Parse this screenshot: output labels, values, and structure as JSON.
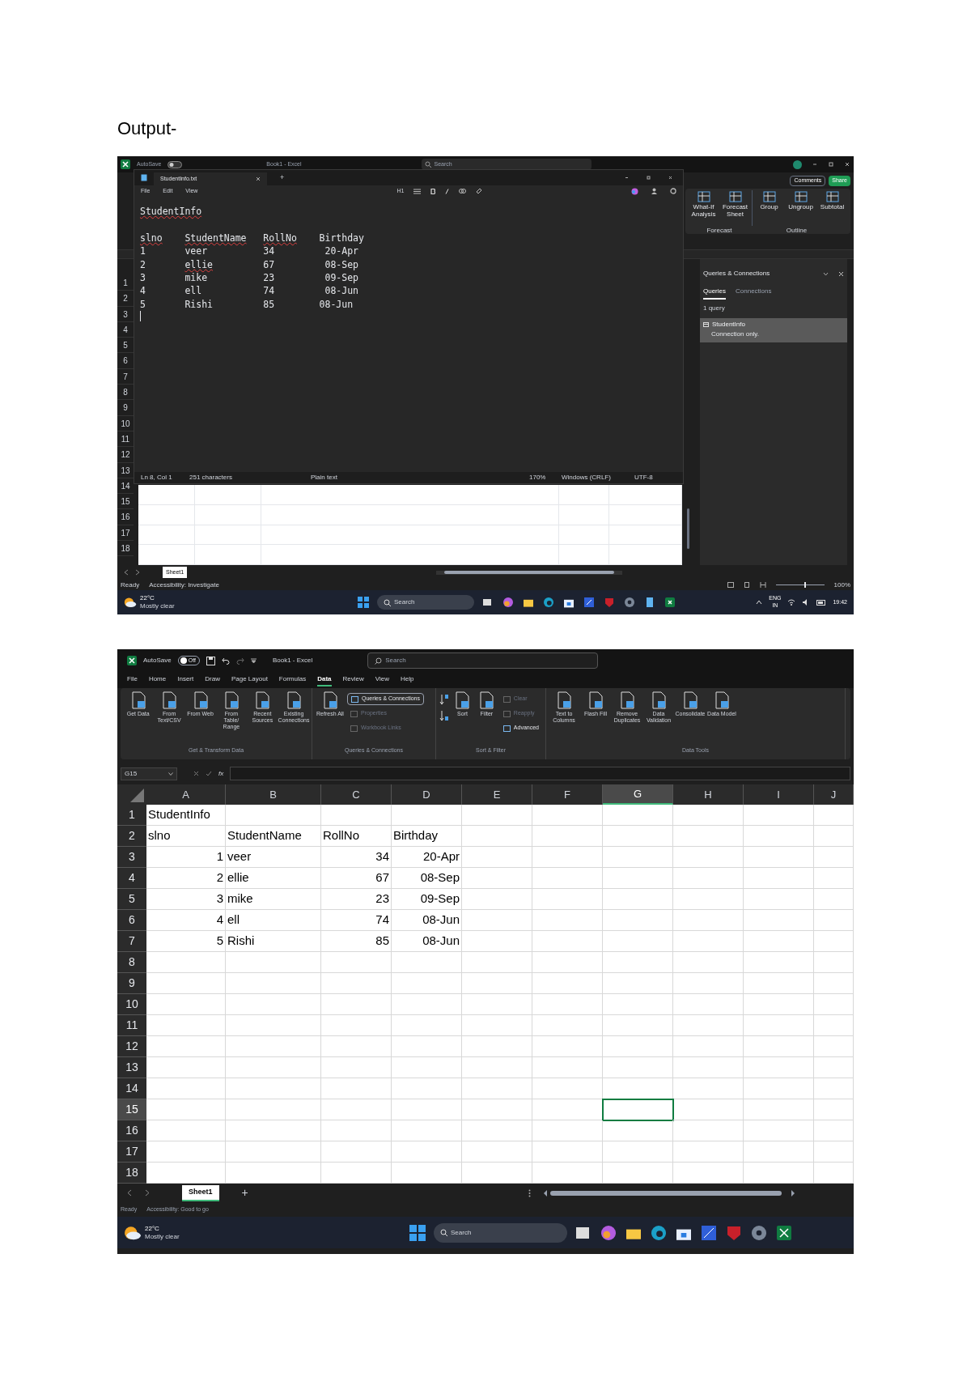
{
  "heading": "Output-",
  "shot1": {
    "excel_title": {
      "autosave": "AutoSave",
      "title": "Book1 - Excel",
      "search": "Search"
    },
    "ribbon_buttons": [
      "Comments",
      "Share"
    ],
    "ribbon_items": [
      "What-If Analysis",
      "Forecast Sheet",
      "Group",
      "Ungroup",
      "Subtotal"
    ],
    "ribbon_groups": [
      "Forecast",
      "Outline"
    ],
    "row_numbers": [
      "1",
      "2",
      "3",
      "4",
      "5",
      "6",
      "7",
      "8",
      "9",
      "10",
      "11",
      "12",
      "13",
      "14",
      "15",
      "16",
      "17",
      "18"
    ],
    "notepad": {
      "tab": "StudentInfo.txt",
      "new_tab": "+",
      "menu": [
        "File",
        "Edit",
        "View"
      ],
      "heading_button": "H1",
      "lines": [
        [
          {
            "text": "StudentInfo",
            "misspelled": true
          }
        ],
        [
          {
            "text": "slno",
            "misspelled": true
          },
          {
            "text": "StudentName",
            "misspelled": true
          },
          {
            "text": "RollNo",
            "misspelled": true
          },
          {
            "text": "Birthday",
            "misspelled": false
          }
        ],
        [
          {
            "text": "1",
            "misspelled": false
          },
          {
            "text": "veer",
            "misspelled": false
          },
          {
            "text": "34",
            "misspelled": false
          },
          {
            "text": " 20-Apr",
            "misspelled": false
          }
        ],
        [
          {
            "text": "2",
            "misspelled": false
          },
          {
            "text": "ellie",
            "misspelled": true
          },
          {
            "text": "67",
            "misspelled": false
          },
          {
            "text": " 08-Sep",
            "misspelled": false
          }
        ],
        [
          {
            "text": "3",
            "misspelled": false
          },
          {
            "text": "mike",
            "misspelled": false
          },
          {
            "text": "23",
            "misspelled": false
          },
          {
            "text": " 09-Sep",
            "misspelled": false
          }
        ],
        [
          {
            "text": "4",
            "misspelled": false
          },
          {
            "text": "ell",
            "misspelled": false
          },
          {
            "text": "74",
            "misspelled": false
          },
          {
            "text": " 08-Jun",
            "misspelled": false
          }
        ],
        [
          {
            "text": "5",
            "misspelled": false
          },
          {
            "text": "Rishi",
            "misspelled": false
          },
          {
            "text": "85",
            "misspelled": false
          },
          {
            "text": "08-Jun",
            "misspelled": false
          }
        ]
      ],
      "status": [
        "Ln 8, Col 1",
        "251 characters",
        "Plain text",
        "170%",
        "Windows (CRLF)",
        "UTF-8"
      ]
    },
    "queries_panel": {
      "title": "Queries & Connections",
      "tabs": [
        {
          "label": "Queries",
          "selected": true
        },
        {
          "label": "Connections",
          "selected": false
        }
      ],
      "count": "1 query",
      "item": {
        "name": "StudentInfo",
        "detail": "Connection only."
      }
    },
    "sheet_tab": "Sheet1",
    "status": [
      "Ready",
      "Accessibility: Investigate"
    ],
    "zoom": "100%",
    "zoom_slider": {
      "level": 0.6
    },
    "taskbar": {
      "temperature": "22°C",
      "weather": "Mostly clear",
      "search": "Search",
      "language": "ENG",
      "region": "IN",
      "time": "19:42"
    }
  },
  "shot2": {
    "title_bar": {
      "autosave": "AutoSave",
      "toggle": "Off",
      "title": "Book1 - Excel",
      "search": "Search"
    },
    "tabs": [
      {
        "label": "File",
        "selected": false
      },
      {
        "label": "Home",
        "selected": false
      },
      {
        "label": "Insert",
        "selected": false
      },
      {
        "label": "Draw",
        "selected": false
      },
      {
        "label": "Page Layout",
        "selected": false
      },
      {
        "label": "Formulas",
        "selected": false
      },
      {
        "label": "Data",
        "selected": true
      },
      {
        "label": "Review",
        "selected": false
      },
      {
        "label": "View",
        "selected": false
      },
      {
        "label": "Help",
        "selected": false
      }
    ],
    "ribbon_groups": [
      {
        "label": "Get & Transform Data",
        "items": [
          {
            "kind": "large",
            "label": "Get Data"
          },
          {
            "kind": "large",
            "label": "From Text/CSV"
          },
          {
            "kind": "large",
            "label": "From Web"
          },
          {
            "kind": "large",
            "label": "From Table/ Range"
          },
          {
            "kind": "large",
            "label": "Recent Sources"
          },
          {
            "kind": "large",
            "label": "Existing Connections"
          }
        ]
      },
      {
        "label": "Queries & Connections",
        "items": [
          {
            "kind": "large",
            "label": "Refresh All"
          },
          {
            "kind": "small",
            "label": "Queries & Connections",
            "disabled": false
          },
          {
            "kind": "small",
            "label": "Properties",
            "disabled": true
          },
          {
            "kind": "small",
            "label": "Workbook Links",
            "disabled": true
          }
        ]
      },
      {
        "label": "Sort & Filter",
        "items": [
          {
            "kind": "sort"
          },
          {
            "kind": "large",
            "label": "Sort"
          },
          {
            "kind": "large",
            "label": "Filter"
          },
          {
            "kind": "small",
            "label": "Clear",
            "disabled": true
          },
          {
            "kind": "small",
            "label": "Reapply",
            "disabled": true
          },
          {
            "kind": "small",
            "label": "Advanced",
            "disabled": false
          }
        ]
      },
      {
        "label": "Data Tools",
        "items": [
          {
            "kind": "large",
            "label": "Text to Columns"
          },
          {
            "kind": "large",
            "label": "Flash Fill"
          },
          {
            "kind": "large",
            "label": "Remove Duplicates"
          },
          {
            "kind": "large",
            "label": "Data Validation"
          },
          {
            "kind": "large",
            "label": "Consolidate"
          },
          {
            "kind": "large",
            "label": "Data Model"
          }
        ]
      }
    ],
    "name_box": "G15",
    "fx": "fx",
    "columns": [
      {
        "label": "A",
        "selected": false
      },
      {
        "label": "B",
        "selected": false
      },
      {
        "label": "C",
        "selected": false
      },
      {
        "label": "D",
        "selected": false
      },
      {
        "label": "E",
        "selected": false
      },
      {
        "label": "F",
        "selected": false
      },
      {
        "label": "G",
        "selected": true
      },
      {
        "label": "H",
        "selected": false
      },
      {
        "label": "I",
        "selected": false
      },
      {
        "label": "J",
        "selected": false
      }
    ],
    "rows": [
      {
        "label": "1",
        "selected": false,
        "cells": [
          {
            "text": "StudentInfo",
            "kind": "text"
          }
        ]
      },
      {
        "label": "2",
        "selected": false,
        "cells": [
          {
            "text": "slno",
            "kind": "text"
          },
          {
            "text": "StudentName",
            "kind": "text"
          },
          {
            "text": "RollNo",
            "kind": "text"
          },
          {
            "text": "Birthday",
            "kind": "text"
          }
        ]
      },
      {
        "label": "3",
        "selected": false,
        "cells": [
          {
            "text": "1",
            "kind": "number"
          },
          {
            "text": "veer",
            "kind": "text"
          },
          {
            "text": "34",
            "kind": "number"
          },
          {
            "text": "20-Apr",
            "kind": "number"
          }
        ]
      },
      {
        "label": "4",
        "selected": false,
        "cells": [
          {
            "text": "2",
            "kind": "number"
          },
          {
            "text": "ellie",
            "kind": "text"
          },
          {
            "text": "67",
            "kind": "number"
          },
          {
            "text": "08-Sep",
            "kind": "number"
          }
        ]
      },
      {
        "label": "5",
        "selected": false,
        "cells": [
          {
            "text": "3",
            "kind": "number"
          },
          {
            "text": "mike",
            "kind": "text"
          },
          {
            "text": "23",
            "kind": "number"
          },
          {
            "text": "09-Sep",
            "kind": "number"
          }
        ]
      },
      {
        "label": "6",
        "selected": false,
        "cells": [
          {
            "text": "4",
            "kind": "number"
          },
          {
            "text": "ell",
            "kind": "text"
          },
          {
            "text": "74",
            "kind": "number"
          },
          {
            "text": "08-Jun",
            "kind": "number"
          }
        ]
      },
      {
        "label": "7",
        "selected": false,
        "cells": [
          {
            "text": "5",
            "kind": "number"
          },
          {
            "text": "Rishi",
            "kind": "text"
          },
          {
            "text": "85",
            "kind": "number"
          },
          {
            "text": "08-Jun",
            "kind": "number"
          }
        ]
      },
      {
        "label": "8",
        "selected": false,
        "cells": []
      },
      {
        "label": "9",
        "selected": false,
        "cells": []
      },
      {
        "label": "10",
        "selected": false,
        "cells": []
      },
      {
        "label": "11",
        "selected": false,
        "cells": []
      },
      {
        "label": "12",
        "selected": false,
        "cells": []
      },
      {
        "label": "13",
        "selected": false,
        "cells": []
      },
      {
        "label": "14",
        "selected": false,
        "cells": []
      },
      {
        "label": "15",
        "selected": true,
        "cells": []
      },
      {
        "label": "16",
        "selected": false,
        "cells": []
      },
      {
        "label": "17",
        "selected": false,
        "cells": []
      },
      {
        "label": "18",
        "selected": false,
        "cells": []
      }
    ],
    "sheet_tab": "Sheet1",
    "add_sheet": "+",
    "status": [
      "Ready",
      "Accessibility: Good to go"
    ],
    "taskbar": {
      "temperature": "22°C",
      "weather": "Mostly clear",
      "search": "Search"
    }
  }
}
